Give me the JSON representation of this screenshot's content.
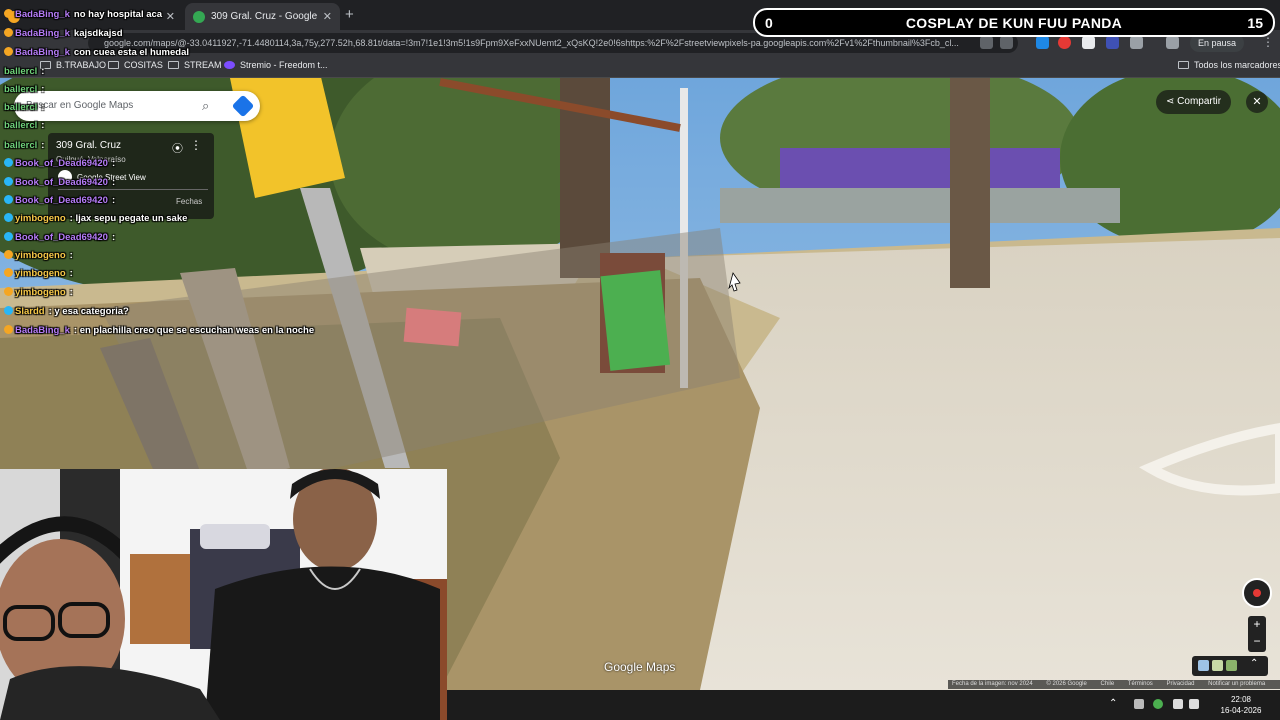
{
  "browser": {
    "tabs": [
      {
        "title": "",
        "active": false
      },
      {
        "title": "309 Gral. Cruz - Google Maps",
        "active": true
      }
    ],
    "new_tab_label": "+",
    "url": "google.com/maps/@-33.0411927,-71.4480114,3a,75y,277.52h,68.81t/data=!3m7!1e1!3m5!1s9Fpm9XeFxxNUemt2_xQsKQ!2e0!6shttps:%2F%2Fstreetviewpixels-pa.googleapis.com%2Fv1%2Fthumbnail%3Fcb_cl...",
    "profile_status": "En pausa",
    "bookmarks": [
      "B.TRABAJO",
      "COSITAS",
      "STREAM",
      "Stremio - Freedom t..."
    ],
    "all_bookmarks": "Todos los marcadores"
  },
  "maps": {
    "search_placeholder": "Buscar en Google Maps",
    "place_name": "309 Gral. Cruz",
    "place_sub": "Quilpué, Valparaíso",
    "street_view_label": "Google Street View",
    "more_label": "Fechas",
    "share_label": "Compartir",
    "close_label": "✕",
    "zoom_in": "+",
    "zoom_out": "−",
    "watermark": "Google Maps",
    "attribution": [
      "Fecha de la imagen: nov 2024",
      "© 2026 Google",
      "Chile",
      "Términos",
      "Privacidad",
      "Notificar un problema"
    ]
  },
  "chat": [
    {
      "user": "BadaBing_k",
      "text": "no hay hospital aca",
      "color": "#b57cf7",
      "badge": "#f5a623"
    },
    {
      "user": "BadaBing_k",
      "text": "kajsdkajsd",
      "color": "#b57cf7",
      "badge": "#f5a623"
    },
    {
      "user": "BadaBing_k",
      "text": "con cuea esta el humedal",
      "color": "#b57cf7",
      "badge": "#f5a623"
    },
    {
      "user": "ballercl",
      "text": ":",
      "color": "#6fd27a",
      "badge": ""
    },
    {
      "user": "ballercl",
      "text": ":",
      "color": "#6fd27a",
      "badge": ""
    },
    {
      "user": "ballercl",
      "text": ":",
      "color": "#6fd27a",
      "badge": ""
    },
    {
      "user": "ballercl",
      "text": ":",
      "color": "#6fd27a",
      "badge": ""
    },
    {
      "user": "ballercl",
      "text": ":",
      "color": "#6fd27a",
      "badge": ""
    },
    {
      "user": "Book_of_Dead69420",
      "text": ":",
      "color": "#b57cf7",
      "badge": "#29b6f6"
    },
    {
      "user": "Book_of_Dead69420",
      "text": ":",
      "color": "#b57cf7",
      "badge": "#29b6f6"
    },
    {
      "user": "Book_of_Dead69420",
      "text": ":",
      "color": "#b57cf7",
      "badge": "#29b6f6"
    },
    {
      "user": "yimbogeno",
      "text": ": ljax sepu pegate un sake",
      "color": "#f7c948",
      "badge": "#29b6f6"
    },
    {
      "user": "Book_of_Dead69420",
      "text": ":",
      "color": "#b57cf7",
      "badge": "#29b6f6"
    },
    {
      "user": "yimbogeno",
      "text": ":",
      "color": "#f7c948",
      "badge": "#f5a623"
    },
    {
      "user": "yimbogeno",
      "text": ":",
      "color": "#f7c948",
      "badge": "#f5a623"
    },
    {
      "user": "yimbogeno",
      "text": ":",
      "color": "#f7c948",
      "badge": "#f5a623"
    },
    {
      "user": "Slardd",
      "text": ": y esa categoria?",
      "color": "#f7c948",
      "badge": "#29b6f6"
    },
    {
      "user": "BadaBing_k",
      "text": ": en plachilla creo que se escuchan weas en la noche",
      "color": "#b57cf7",
      "badge": "#f5a623"
    }
  ],
  "overlay": {
    "left": "0",
    "title": "COSPLAY DE KUN FUU PANDA",
    "right": "15"
  },
  "taskbar": {
    "time": "22:08",
    "date": "16-04-2026"
  }
}
